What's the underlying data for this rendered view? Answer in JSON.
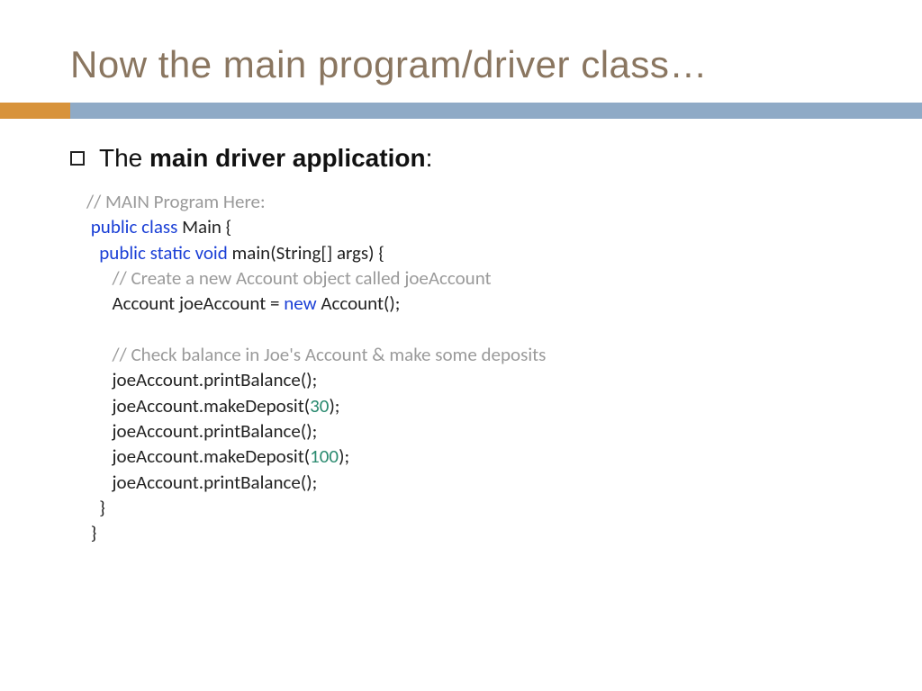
{
  "title": "Now the main program/driver class…",
  "bullet": {
    "prefix": "The ",
    "bold": "main driver application",
    "suffix": ":"
  },
  "code": {
    "l01": "// MAIN Program Here:",
    "l02a": "public class ",
    "l02b": "Main {",
    "l03a": "public static void ",
    "l03b": "main(String[] args) {",
    "l04": "// Create a new Account object called joeAccount",
    "l05a": "Account joeAccount = ",
    "l05b": "new ",
    "l05c": "Account();",
    "l06": "// Check balance in Joe's Account & make some deposits",
    "l07": "joeAccount.printBalance();",
    "l08a": "joeAccount.makeDeposit(",
    "l08b": "30",
    "l08c": ");",
    "l09": "joeAccount.printBalance();",
    "l10a": "joeAccount.makeDeposit(",
    "l10b": "100",
    "l10c": ");",
    "l11": "joeAccount.printBalance();",
    "l12": "}",
    "l13": "}"
  }
}
